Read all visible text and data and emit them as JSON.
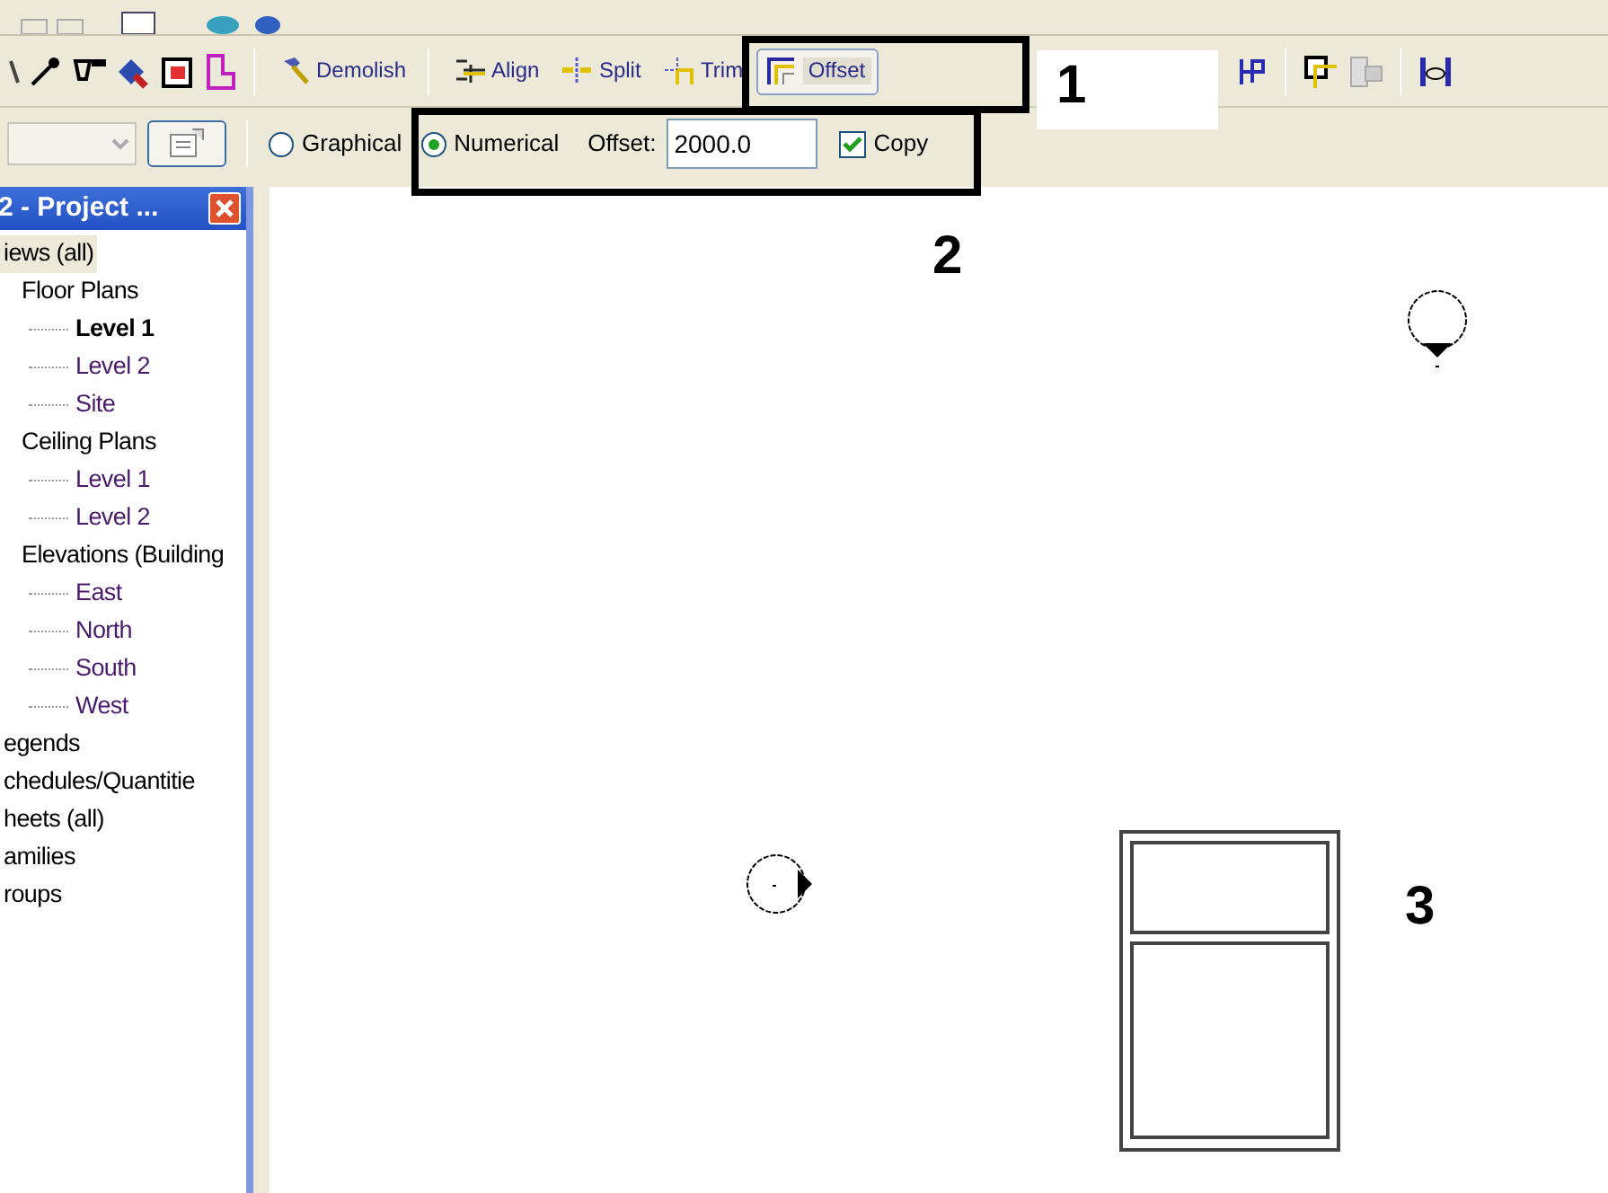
{
  "toolbar": {
    "buttons": [
      {
        "label": "Demolish",
        "selected": false
      },
      {
        "label": "Align",
        "selected": false
      },
      {
        "label": "Split",
        "selected": false
      },
      {
        "label": "Trim",
        "selected": false
      },
      {
        "label": "Offset",
        "selected": true
      }
    ]
  },
  "options_bar": {
    "modes": [
      {
        "label": "Graphical",
        "selected": false
      },
      {
        "label": "Numerical",
        "selected": true
      }
    ],
    "offset_label": "Offset:",
    "offset_value": "2000.0",
    "copy": {
      "label": "Copy",
      "checked": true
    }
  },
  "project_browser": {
    "title": "2 - Project ...",
    "items": [
      {
        "label": "iews (all)",
        "selected": true,
        "open_view": false,
        "children": [
          {
            "label": "Floor Plans",
            "selected": false,
            "open_view": false,
            "children": [
              {
                "label": "Level 1",
                "selected": false,
                "open_view": true
              },
              {
                "label": "Level 2",
                "selected": false,
                "open_view": false
              },
              {
                "label": "Site",
                "selected": false,
                "open_view": false
              }
            ]
          },
          {
            "label": "Ceiling Plans",
            "selected": false,
            "open_view": false,
            "children": [
              {
                "label": "Level 1",
                "selected": false,
                "open_view": false
              },
              {
                "label": "Level 2",
                "selected": false,
                "open_view": false
              }
            ]
          },
          {
            "label": "Elevations (Building",
            "selected": false,
            "open_view": false,
            "children": [
              {
                "label": "East",
                "selected": false,
                "open_view": false
              },
              {
                "label": "North",
                "selected": false,
                "open_view": false
              },
              {
                "label": "South",
                "selected": false,
                "open_view": false
              },
              {
                "label": "West",
                "selected": false,
                "open_view": false
              }
            ]
          }
        ]
      },
      {
        "label": "egends",
        "selected": false,
        "open_view": false
      },
      {
        "label": "chedules/Quantitie",
        "selected": false,
        "open_view": false
      },
      {
        "label": "heets (all)",
        "selected": false,
        "open_view": false
      },
      {
        "label": "amilies",
        "selected": false,
        "open_view": false
      },
      {
        "label": "roups",
        "selected": false,
        "open_view": false
      }
    ]
  },
  "annotations": [
    {
      "label": "1"
    },
    {
      "label": "2"
    },
    {
      "label": "3"
    }
  ]
}
